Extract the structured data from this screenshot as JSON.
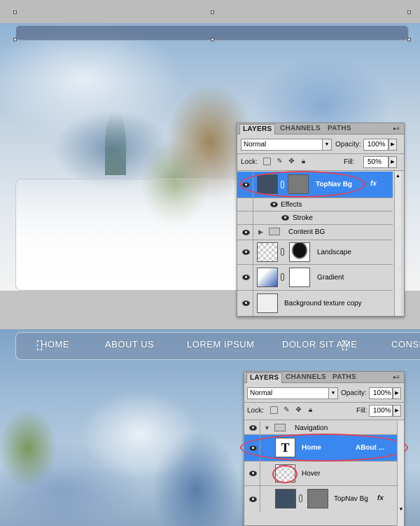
{
  "top_panel": {
    "tabs": [
      "LAYERS",
      "CHANNELS",
      "PATHS"
    ],
    "blend_mode": "Normal",
    "opacity_label": "Opacity:",
    "opacity": "100%",
    "lock_label": "Lock:",
    "fill_label": "Fill:",
    "fill": "50%",
    "layers": {
      "topnav": "TopNav Bg",
      "effects": "Effects",
      "stroke": "Stroke",
      "content_bg": "Content BG",
      "landscape": "Landscape",
      "gradient": "Gradient",
      "bg_texture": "Background texture copy"
    },
    "fx": "fx"
  },
  "nav": {
    "items": [
      "HOME",
      "ABOUT US",
      "LOREM IPSUM",
      "DOLOR SIT AME",
      "CONSE"
    ]
  },
  "bottom_panel": {
    "tabs": [
      "LAYERS",
      "CHANNELS",
      "PATHS"
    ],
    "blend_mode": "Normal",
    "opacity_label": "Opacity:",
    "opacity": "100%",
    "lock_label": "Lock:",
    "fill_label": "Fill:",
    "fill": "100%",
    "layers": {
      "navigation": "Navigation",
      "home": "Home",
      "home_extra": "ABout ...",
      "hover": "Hover",
      "topnav": "TopNav Bg"
    },
    "text_thumb": "T",
    "fx": "fx"
  },
  "colors": {
    "selection": "#3a87f0",
    "highlight_ring": "#d9455c",
    "panel_bg": "#d6d6d6"
  }
}
